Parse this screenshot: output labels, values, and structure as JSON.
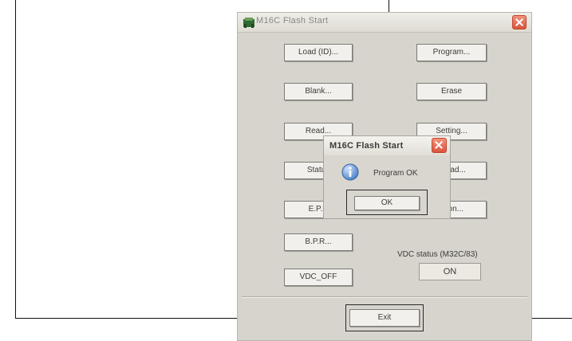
{
  "main_window": {
    "title": "M16C Flash Start",
    "buttons": {
      "load_id": "Load (ID)...",
      "program": "Program...",
      "blank": "Blank...",
      "erase": "Erase",
      "read": "Read...",
      "setting": "Setting...",
      "status": "Status",
      "download": "...load...",
      "epr": "E.P.R",
      "version": "...ion...",
      "bpr": "B.P.R...",
      "vdc_off": "VDC_OFF",
      "exit": "Exit"
    },
    "vdc_status_label": "VDC status (M32C/83)",
    "vdc_status_value": "ON"
  },
  "dialog": {
    "title": "M16C Flash Start",
    "message": "Program OK",
    "ok_label": "OK"
  },
  "icons": {
    "app": "chip-icon",
    "close": "close-icon",
    "info": "info-icon"
  },
  "colors": {
    "window_bg": "#d7d4cd",
    "close_button": "#d9543c",
    "info_icon": "#3f77c5"
  }
}
